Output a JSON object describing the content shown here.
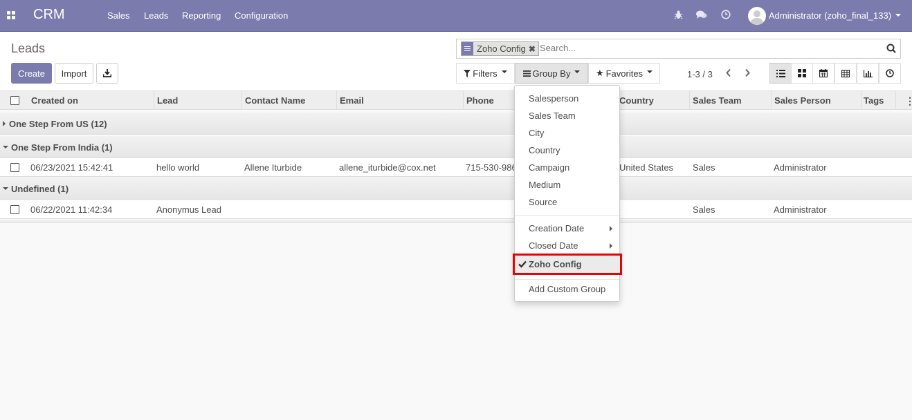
{
  "navbar": {
    "brand": "CRM",
    "menu": [
      "Sales",
      "Leads",
      "Reporting",
      "Configuration"
    ],
    "user": "Administrator (zoho_final_133)",
    "icons": [
      "bug-icon",
      "chat-icon",
      "clock-icon"
    ],
    "bg_color": "#7c7bad"
  },
  "control": {
    "title": "Leads",
    "create_label": "Create",
    "import_label": "Import",
    "facet_label": "Zoho Config",
    "search_placeholder": "Search...",
    "filters_label": "Filters",
    "groupby_label": "Group By",
    "favorites_label": "Favorites",
    "pager": "1-3 / 3"
  },
  "table": {
    "columns": [
      "Created on",
      "Lead",
      "Contact Name",
      "Email",
      "Phone",
      "Country",
      "Sales Team",
      "Sales Person",
      "Tags"
    ],
    "groups": [
      {
        "label": "One Step From US (12)",
        "expanded": false,
        "rows": []
      },
      {
        "label": "One Step From India (1)",
        "expanded": true,
        "rows": [
          {
            "created_on": "06/23/2021 15:42:41",
            "lead": "hello world",
            "contact": "Allene Iturbide",
            "email": "allene_iturbide@cox.net",
            "phone": "715-530-9863",
            "country": "United States",
            "team": "Sales",
            "person": "Administrator"
          }
        ]
      },
      {
        "label": "Undefined (1)",
        "expanded": true,
        "rows": [
          {
            "created_on": "06/22/2021 11:42:34",
            "lead": "Anonymus Lead",
            "contact": "",
            "email": "",
            "phone": "",
            "country": "",
            "team": "Sales",
            "person": "Administrator"
          }
        ]
      }
    ]
  },
  "groupby_menu": {
    "fields": [
      "Salesperson",
      "Sales Team",
      "City",
      "Country",
      "Campaign",
      "Medium",
      "Source"
    ],
    "date_fields": [
      "Creation Date",
      "Closed Date"
    ],
    "selected": "Zoho Config",
    "custom": "Add Custom Group",
    "highlight_color": "#ee0000"
  }
}
